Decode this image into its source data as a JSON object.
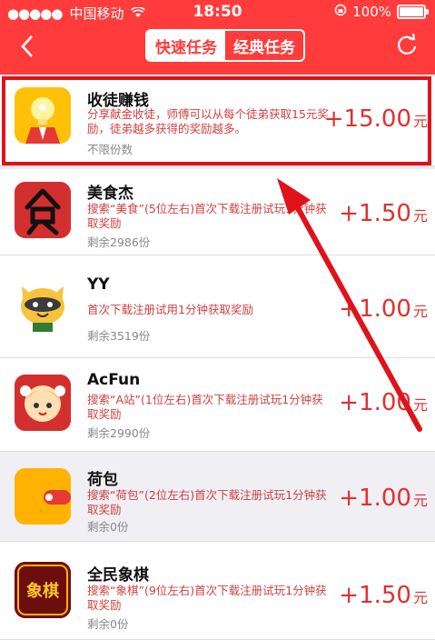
{
  "status": {
    "carrier": "中国移动",
    "time": "18:50",
    "battery": "100%"
  },
  "nav": {
    "tabs": [
      "快速任务",
      "经典任务"
    ]
  },
  "items": [
    {
      "name": "收徒赚钱",
      "desc": "分享献金收徒，师傅可以从每个徒弟获取15元奖励，徒弟越多获得的奖励越多。",
      "remain": "不限份数",
      "price": "+15.00",
      "unit": "元",
      "icon": "bulb-person-icon"
    },
    {
      "name": "美食杰",
      "desc": "搜索“美食”(5位左右)首次下载注册试玩1分钟获取奖励",
      "remain": "剩余2986份",
      "price": "+1.50",
      "unit": "元",
      "icon": "food-char-icon"
    },
    {
      "name": "YY",
      "desc": "首次下载注册试用1分钟获取奖励",
      "remain": "剩余3519份",
      "price": "+1.00",
      "unit": "元",
      "icon": "raccoon-icon"
    },
    {
      "name": "AcFun",
      "desc": "搜索“A站”(1位左右)首次下载注册试玩1分钟获取奖励",
      "remain": "剩余2990份",
      "price": "+1.00",
      "unit": "元",
      "icon": "anime-girl-icon"
    },
    {
      "name": "荷包",
      "desc": "搜索“荷包”(2位左右)首次下载注册试玩1分钟获取奖励",
      "remain": "剩余0份",
      "price": "+1.00",
      "unit": "元",
      "icon": "wallet-icon"
    },
    {
      "name": "全民象棋",
      "desc": "搜索“象棋”(9位左右)首次下载注册试玩1分钟获取奖励",
      "remain": "剩余0份",
      "price": "+1.50",
      "unit": "元",
      "icon": "chess-icon",
      "icon_text": "象棋"
    }
  ],
  "colors": {
    "brand_red": "#ff3b3b",
    "price_red": "#e03030",
    "highlight_red": "#e0121a"
  }
}
